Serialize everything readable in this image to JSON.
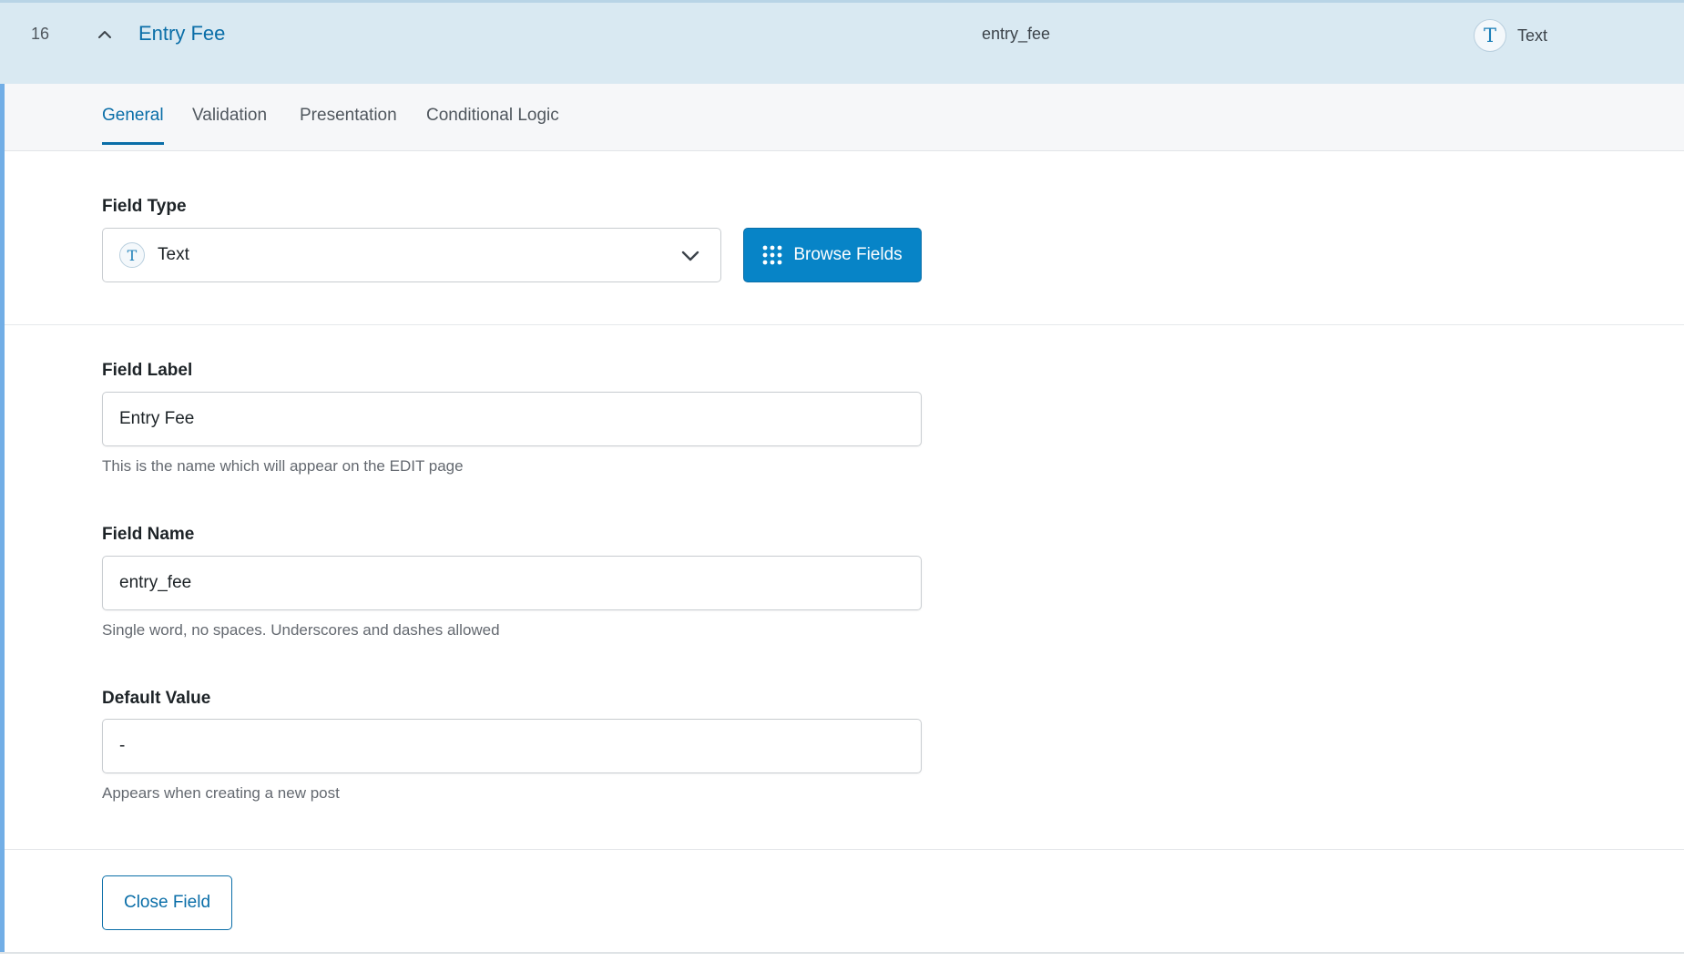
{
  "header": {
    "row_number": "16",
    "field_label": "Entry Fee",
    "field_name": "entry_fee",
    "type_icon": "T",
    "type_label": "Text"
  },
  "tabs": [
    {
      "label": "General",
      "active": true
    },
    {
      "label": "Validation",
      "active": false
    },
    {
      "label": "Presentation",
      "active": false
    },
    {
      "label": "Conditional Logic",
      "active": false
    }
  ],
  "field_type": {
    "label": "Field Type",
    "icon": "T",
    "selected": "Text",
    "browse_button": "Browse Fields"
  },
  "field_label": {
    "label": "Field Label",
    "value": "Entry Fee",
    "help": "This is the name which will appear on the EDIT page"
  },
  "field_name": {
    "label": "Field Name",
    "value": "entry_fee",
    "help": "Single word, no spaces. Underscores and dashes allowed"
  },
  "default_value": {
    "label": "Default Value",
    "value": "-",
    "help": "Appears when creating a new post"
  },
  "close_button": "Close Field",
  "icons": {
    "collapse": "chevron-up-icon",
    "type": "text-type-icon",
    "dropdown": "chevron-down-icon",
    "browse": "grid-icon"
  },
  "colors": {
    "accent": "#0a6ea8",
    "header_bg": "#d9e9f2",
    "button_bg": "#0784c7"
  }
}
